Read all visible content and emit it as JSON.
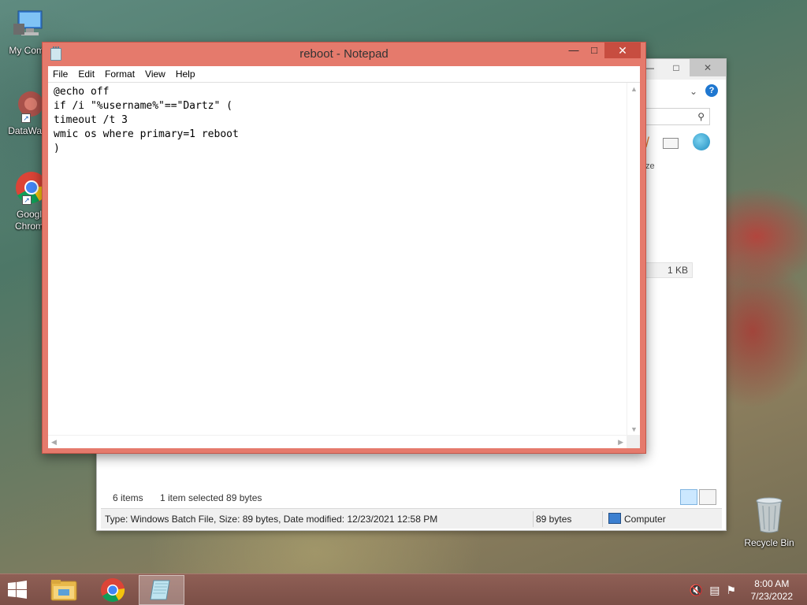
{
  "desktop": {
    "icons": [
      {
        "label": "My Comp"
      },
      {
        "label": "DataWag"
      },
      {
        "label": "Googl Chrom"
      }
    ],
    "recycle_bin": "Recycle Bin"
  },
  "explorer": {
    "partial_label": "ze",
    "file_size": "1 KB",
    "items_count": "6 items",
    "selected": "1 item selected  89 bytes",
    "status_details": "Type: Windows Batch File, Size: 89 bytes, Date modified: 12/23/2021 12:58 PM",
    "status_size": "89 bytes",
    "status_location": "Computer"
  },
  "notepad": {
    "title": "reboot - Notepad",
    "menu": [
      "File",
      "Edit",
      "Format",
      "View",
      "Help"
    ],
    "content": "@echo off\nif /i \"%username%\"==\"Dartz\" (\ntimeout /t 3\nwmic os where primary=1 reboot\n)"
  },
  "taskbar": {
    "time": "8:00 AM",
    "date": "7/23/2022"
  },
  "colors": {
    "accent": "#e57a6c",
    "close_button": "#c74d40",
    "taskbar": "#7b4f47"
  }
}
